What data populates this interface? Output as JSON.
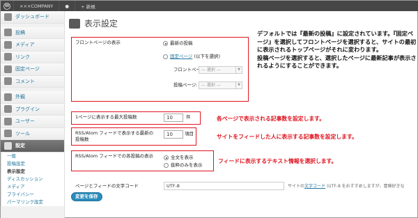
{
  "adminbar": {
    "site_name": "×××COMPANY",
    "new_label": "+ 新規"
  },
  "sidebar": {
    "items": [
      {
        "label": "ダッシュボード"
      },
      {
        "label": "投稿"
      },
      {
        "label": "メディア"
      },
      {
        "label": "リンク"
      },
      {
        "label": "固定ページ"
      },
      {
        "label": "コメント"
      },
      {
        "label": "外観"
      },
      {
        "label": "プラグイン"
      },
      {
        "label": "ユーザー"
      },
      {
        "label": "ツール"
      },
      {
        "label": "設定"
      }
    ],
    "submenu": [
      "一般",
      "投稿設定",
      "表示設定",
      "ディスカッション",
      "メディア",
      "プライバシー",
      "パーマリンク設定"
    ]
  },
  "page": {
    "title": "表示設定",
    "front_label": "フロントページの表示",
    "radio_latest": "最新の投稿",
    "radio_static_link": "固定ページ",
    "radio_static_rest": " (以下を選択)",
    "front_page_label": "フロントページ:",
    "posts_page_label": "投稿ページ:",
    "select_placeholder": "— 選択 —",
    "per_page_label": "1ページに表示する最大投稿数",
    "per_page_value": "10",
    "per_page_unit": "件",
    "feed_label": "RSS/Atom フィードで表示する最新の投稿数",
    "feed_value": "10",
    "feed_unit": "項目",
    "feed_show_label": "RSS/Atom フィードでの各投稿の表示",
    "radio_full": "全文を表示",
    "radio_summary": "抜粋のみを表示",
    "charset_label": "ページとフィードの文字コード",
    "charset_value": "UTF-8",
    "charset_help_pre": "サイトの",
    "charset_help_link": "文字コード",
    "charset_help_post": " (UTF-8 をおすすめしますが、冒険好きな",
    "save_button": "変更を保存"
  },
  "notes": {
    "front": "デフォルトでは『最新の投稿』に設定されています。『固定ページ』を選択してフロントページを選択すると、サイトの最初に表示されるトップページがそれに変わります。\n投稿ページを選択すると、選択したページに最新記事が表示されるようにすることができます。",
    "per_page": "各ページで表示される記事数を設定します。",
    "feed": "サイトをフィードした人に表示する記事数を設定します。",
    "feed_show": "フィードに表示するテキスト情報を選択します。"
  }
}
